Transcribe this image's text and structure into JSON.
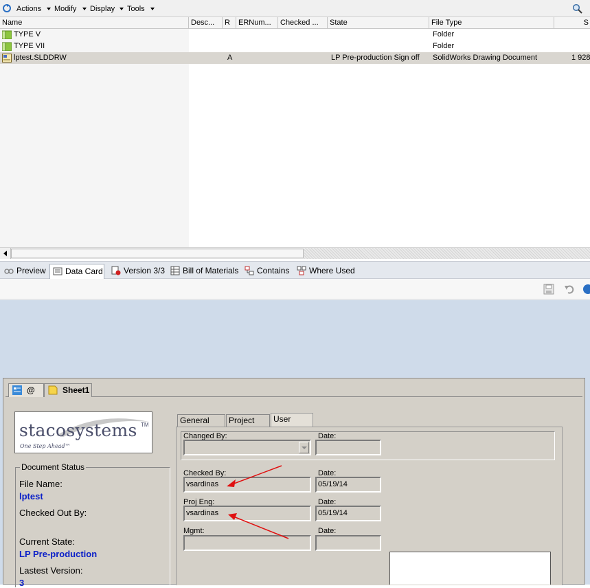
{
  "toolbar": {
    "menus": [
      "Actions",
      "Modify",
      "Display",
      "Tools"
    ]
  },
  "file_list": {
    "columns": [
      "Name",
      "Desc...",
      "R",
      "ERNum...",
      "Checked ...",
      "State",
      "File Type",
      "S"
    ],
    "rows": [
      {
        "name": "TYPE V",
        "revision": "",
        "state": "",
        "file_type": "Folder",
        "size": "",
        "kind": "folder"
      },
      {
        "name": "TYPE VII",
        "revision": "",
        "state": "",
        "file_type": "Folder",
        "size": "",
        "kind": "folder"
      },
      {
        "name": "lptest.SLDDRW",
        "revision": "A",
        "state": "LP Pre-production Sign off",
        "file_type": "SolidWorks Drawing Document",
        "size": "1 928",
        "kind": "drawing"
      }
    ]
  },
  "preview_tabs": [
    "Preview",
    "Data Card",
    "Version 3/3",
    "Bill of Materials",
    "Contains",
    "Where Used"
  ],
  "card": {
    "tabs": [
      "@",
      "Sheet1"
    ],
    "logo": {
      "text": "stacosystems",
      "tm": "TM",
      "tagline": "One Step Ahead™"
    },
    "document_status": {
      "legend": "Document Status",
      "file_name_label": "File Name:",
      "file_name": "lptest",
      "checked_out_label": "Checked Out By:",
      "current_state_label": "Current State:",
      "current_state": "LP Pre-production",
      "latest_version_label": "Lastest Version:",
      "latest_version": "3"
    },
    "right_tabs": [
      "General Info",
      "Project Info",
      "User Data"
    ],
    "fields": {
      "changed_by_label": "Changed By:",
      "changed_by": "",
      "changed_date_label": "Date:",
      "changed_date": "",
      "checked_by_label": "Checked By:",
      "checked_by": "vsardinas",
      "checked_date_label": "Date:",
      "checked_date": "05/19/14",
      "proj_eng_label": "Proj Eng:",
      "proj_eng": "vsardinas",
      "proj_eng_date_label": "Date:",
      "proj_eng_date": "05/19/14",
      "mgmt_label": "Mgmt:",
      "mgmt": "",
      "mgmt_date_label": "Date:",
      "mgmt_date": ""
    }
  },
  "colors": {
    "state_blue": "#0b20c8",
    "annotation_red": "#e01010",
    "card_bg": "#d4d0c8",
    "panel_blue": "#cfdbea"
  }
}
